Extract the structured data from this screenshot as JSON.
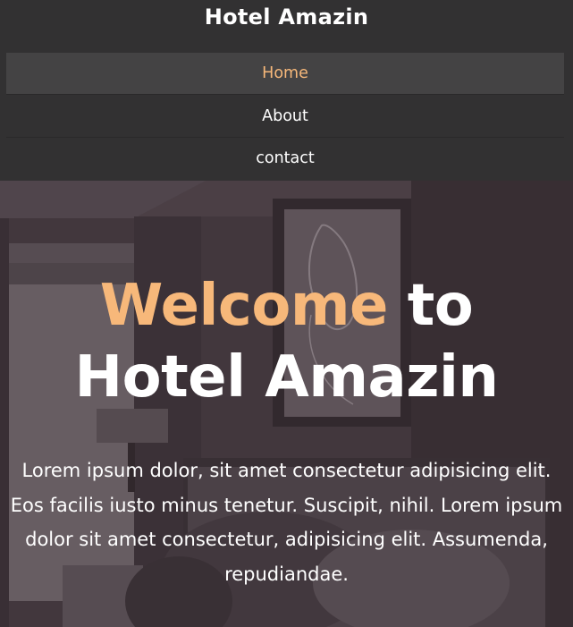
{
  "site": {
    "title": "Hotel Amazin"
  },
  "nav": {
    "items": [
      {
        "label": "Home",
        "active": true
      },
      {
        "label": "About",
        "active": false
      },
      {
        "label": "contact",
        "active": false
      }
    ]
  },
  "hero": {
    "heading_accent": "Welcome",
    "heading_rest_1": " to",
    "heading_rest_2": "Hotel Amazin",
    "description": "Lorem ipsum dolor, sit amet consectetur adipisicing elit. Eos facilis iusto minus tenetur. Suscipit, nihil. Lorem ipsum dolor sit amet consectetur, adipisicing elit. Assumenda, repudiandae."
  },
  "colors": {
    "accent": "#f7b87a",
    "header_bg": "#323132",
    "nav_active_bg": "#444344"
  }
}
